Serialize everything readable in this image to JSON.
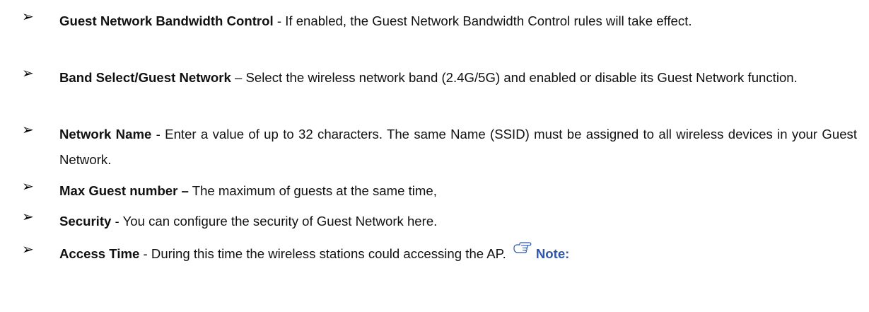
{
  "items": [
    {
      "term": "Guest Network Bandwidth Control",
      "desc": " - If enabled, the Guest Network Bandwidth Control rules will take effect."
    },
    {
      "term": "Band Select/Guest Network",
      "desc": " – Select the wireless network band (2.4G/5G) and enabled or disable its Guest Network function."
    },
    {
      "term": "Network Name",
      "desc": " - Enter a value of up to 32 characters. The same Name (SSID) must be assigned to all wireless devices in your Guest Network."
    },
    {
      "term": "Max Guest number –",
      "desc": " The maximum of guests at the same time,"
    },
    {
      "term": "Security",
      "desc": " - You can configure the security of Guest Network here."
    },
    {
      "term": "Access Time",
      "desc": " - During this time the wireless stations could accessing the AP."
    }
  ],
  "bullet_glyph": "➢",
  "note_icon": "pointing-hand-icon",
  "note_label": "Note:"
}
